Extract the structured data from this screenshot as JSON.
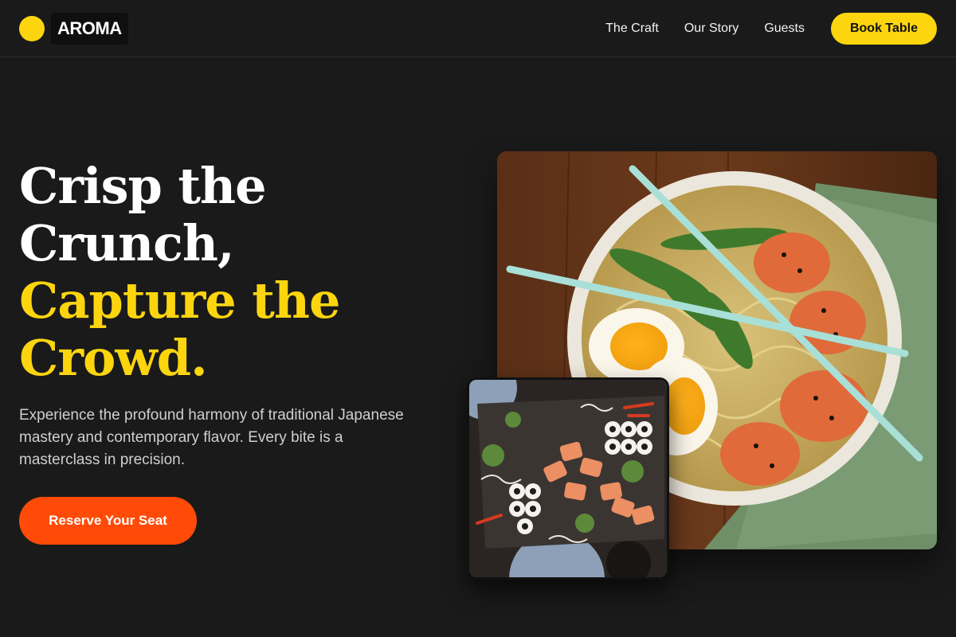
{
  "brand": {
    "name": "AROMA"
  },
  "nav": {
    "links": [
      "The Craft",
      "Our Story",
      "Guests"
    ],
    "cta": "Book Table"
  },
  "hero": {
    "line1": "Crisp the",
    "line2": "Crunch,",
    "line3": "Capture the",
    "line4": "Crowd.",
    "description": "Experience the profound harmony of traditional Japanese mastery and contemporary flavor. Every bite is a masterclass in precision.",
    "cta": "Reserve Your Seat"
  },
  "images": {
    "main": "ramen-bowl-photo",
    "secondary": "sushi-platter-photo"
  },
  "colors": {
    "background": "#1a1a1a",
    "accent_yellow": "#fcd50f",
    "accent_orange": "#ff4b07"
  }
}
